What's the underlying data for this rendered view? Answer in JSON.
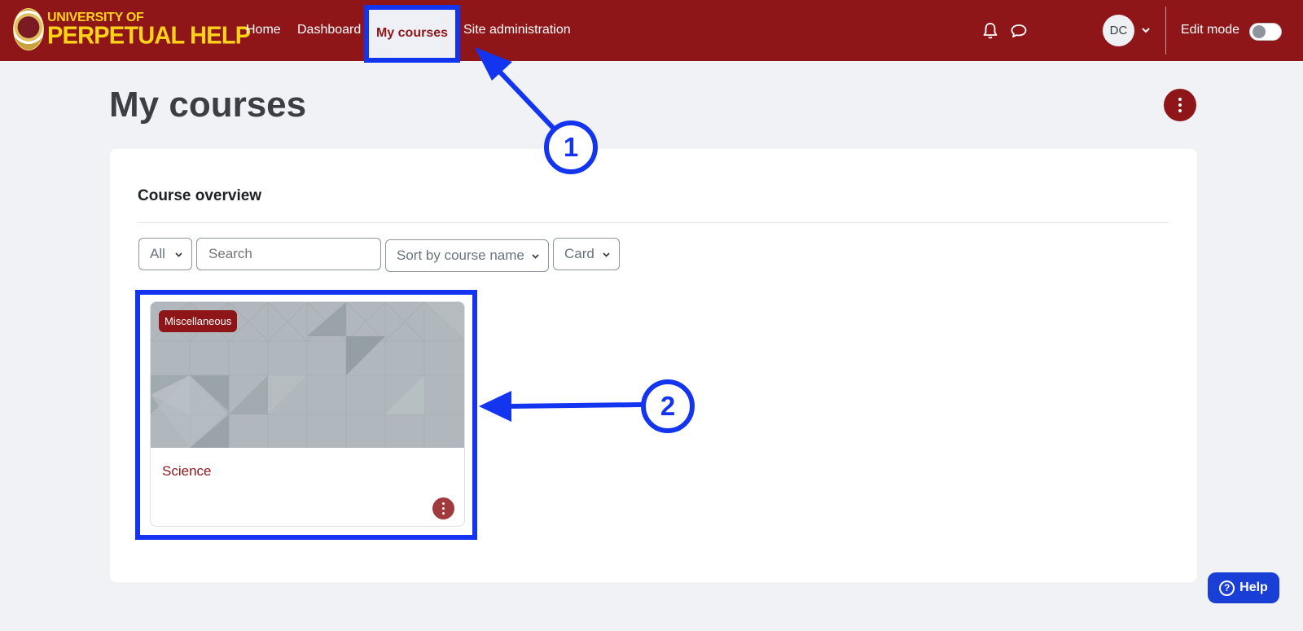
{
  "brand": {
    "line1": "UNIVERSITY OF",
    "line2": "PERPETUAL HELP"
  },
  "nav": {
    "items": [
      {
        "label": "Home"
      },
      {
        "label": "Dashboard"
      },
      {
        "label": "My courses"
      },
      {
        "label": "Site administration"
      }
    ],
    "active": "My courses"
  },
  "user": {
    "initials": "DC"
  },
  "edit_mode": {
    "label": "Edit mode",
    "on": false
  },
  "page": {
    "title": "My courses"
  },
  "overview": {
    "title": "Course overview",
    "filter": {
      "selected": "All"
    },
    "search": {
      "placeholder": "Search"
    },
    "sort": {
      "selected": "Sort by course name"
    },
    "view": {
      "selected": "Card"
    }
  },
  "courses": [
    {
      "category": "Miscellaneous",
      "name": "Science"
    }
  ],
  "annotations": {
    "callout1": "1",
    "callout2": "2"
  },
  "help": {
    "label": "Help",
    "icon": "question-icon"
  },
  "colors": {
    "brand": "#8e1518",
    "brand_yellow": "#ffd21a",
    "annotation": "#1435f0",
    "help": "#1a3fd6",
    "page_bg": "#f1f2f6"
  }
}
